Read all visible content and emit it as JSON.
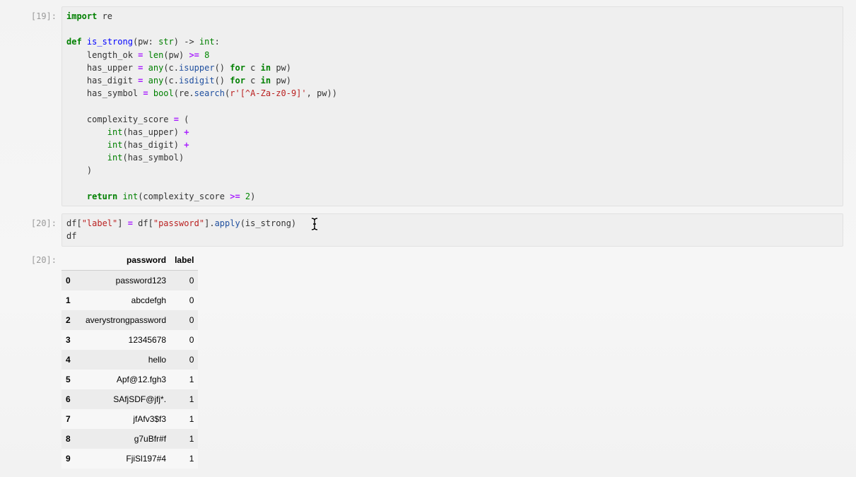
{
  "cells": [
    {
      "prompt": "[19]:",
      "lines": [
        [
          [
            "kw",
            "import"
          ],
          [
            "plain",
            " re"
          ]
        ],
        [],
        [
          [
            "kw",
            "def"
          ],
          [
            "plain",
            " "
          ],
          [
            "def-name",
            "is_strong"
          ],
          [
            "plain",
            "(pw: "
          ],
          [
            "builtin",
            "str"
          ],
          [
            "plain",
            ") -> "
          ],
          [
            "builtin",
            "int"
          ],
          [
            "plain",
            ":"
          ]
        ],
        [
          [
            "plain",
            "    length_ok "
          ],
          [
            "op",
            "="
          ],
          [
            "plain",
            " "
          ],
          [
            "builtin",
            "len"
          ],
          [
            "plain",
            "(pw) "
          ],
          [
            "op",
            ">="
          ],
          [
            "plain",
            " "
          ],
          [
            "num",
            "8"
          ]
        ],
        [
          [
            "plain",
            "    has_upper "
          ],
          [
            "op",
            "="
          ],
          [
            "plain",
            " "
          ],
          [
            "builtin",
            "any"
          ],
          [
            "plain",
            "(c."
          ],
          [
            "attr",
            "isupper"
          ],
          [
            "plain",
            "() "
          ],
          [
            "kw",
            "for"
          ],
          [
            "plain",
            " c "
          ],
          [
            "kw",
            "in"
          ],
          [
            "plain",
            " pw)"
          ]
        ],
        [
          [
            "plain",
            "    has_digit "
          ],
          [
            "op",
            "="
          ],
          [
            "plain",
            " "
          ],
          [
            "builtin",
            "any"
          ],
          [
            "plain",
            "(c."
          ],
          [
            "attr",
            "isdigit"
          ],
          [
            "plain",
            "() "
          ],
          [
            "kw",
            "for"
          ],
          [
            "plain",
            " c "
          ],
          [
            "kw",
            "in"
          ],
          [
            "plain",
            " pw)"
          ]
        ],
        [
          [
            "plain",
            "    has_symbol "
          ],
          [
            "op",
            "="
          ],
          [
            "plain",
            " "
          ],
          [
            "builtin",
            "bool"
          ],
          [
            "plain",
            "(re."
          ],
          [
            "attr",
            "search"
          ],
          [
            "plain",
            "("
          ],
          [
            "str",
            "r'[^A-Za-z0-9]'"
          ],
          [
            "plain",
            ", pw))"
          ]
        ],
        [],
        [
          [
            "plain",
            "    complexity_score "
          ],
          [
            "op",
            "="
          ],
          [
            "plain",
            " ("
          ]
        ],
        [
          [
            "plain",
            "        "
          ],
          [
            "builtin",
            "int"
          ],
          [
            "plain",
            "(has_upper) "
          ],
          [
            "op",
            "+"
          ]
        ],
        [
          [
            "plain",
            "        "
          ],
          [
            "builtin",
            "int"
          ],
          [
            "plain",
            "(has_digit) "
          ],
          [
            "op",
            "+"
          ]
        ],
        [
          [
            "plain",
            "        "
          ],
          [
            "builtin",
            "int"
          ],
          [
            "plain",
            "(has_symbol)"
          ]
        ],
        [
          [
            "plain",
            "    )"
          ]
        ],
        [],
        [
          [
            "plain",
            "    "
          ],
          [
            "kw",
            "return"
          ],
          [
            "plain",
            " "
          ],
          [
            "builtin",
            "int"
          ],
          [
            "plain",
            "(complexity_score "
          ],
          [
            "op",
            ">="
          ],
          [
            "plain",
            " "
          ],
          [
            "num",
            "2"
          ],
          [
            "plain",
            ")"
          ]
        ]
      ]
    },
    {
      "prompt": "[20]:",
      "lines": [
        [
          [
            "plain",
            "df["
          ],
          [
            "str",
            "\"label\""
          ],
          [
            "plain",
            "] "
          ],
          [
            "op",
            "="
          ],
          [
            "plain",
            " df["
          ],
          [
            "str",
            "\"password\""
          ],
          [
            "plain",
            "]."
          ],
          [
            "attr",
            "apply"
          ],
          [
            "plain",
            "(is_strong)"
          ]
        ],
        [
          [
            "plain",
            "df"
          ]
        ]
      ]
    }
  ],
  "output": {
    "prompt": "[20]:",
    "columns": [
      "password",
      "label"
    ],
    "rows": [
      {
        "index": "0",
        "password": "password123",
        "label": "0"
      },
      {
        "index": "1",
        "password": "abcdefgh",
        "label": "0"
      },
      {
        "index": "2",
        "password": "averystrongpassword",
        "label": "0"
      },
      {
        "index": "3",
        "password": "12345678",
        "label": "0"
      },
      {
        "index": "4",
        "password": "hello",
        "label": "0"
      },
      {
        "index": "5",
        "password": "Apf@12.fgh3",
        "label": "1"
      },
      {
        "index": "6",
        "password": "SAfjSDF@jfj*.",
        "label": "1"
      },
      {
        "index": "7",
        "password": "jfAfv3$f3",
        "label": "1"
      },
      {
        "index": "8",
        "password": "g7uBfr#f",
        "label": "1"
      },
      {
        "index": "9",
        "password": "FjiSl197#4",
        "label": "1"
      }
    ]
  },
  "colors": {
    "keyword": "#008000",
    "string": "#ba2121",
    "operator": "#aa22ff",
    "function_name": "#0000ff"
  }
}
